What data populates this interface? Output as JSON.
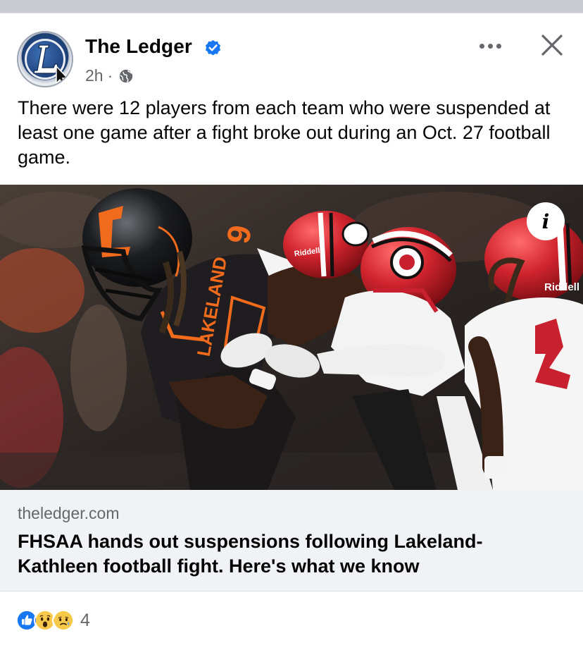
{
  "post": {
    "page_name": "The Ledger",
    "time": "2h",
    "separator": "·",
    "text": "There were 12 players from each team who were suspended at least one game after a fight broke out during an Oct. 27 football game."
  },
  "link": {
    "domain": "theledger.com",
    "title": "FHSAA hands out suspensions following Lakeland-Kathleen football fight. Here's what we know"
  },
  "photo": {
    "info_glyph": "i",
    "jersey_number": "6",
    "jersey_text": "LAKELAND",
    "helmet_brand": "Riddell"
  },
  "reactions": {
    "count": "4",
    "types": [
      "like",
      "wow",
      "sad"
    ]
  },
  "colors": {
    "verified": "#1877f2",
    "like": "#1877f2",
    "secondary_text": "#65676b",
    "link_bg": "#f0f2f5",
    "lakeland_orange": "#f26b1d",
    "kathleen_red": "#c8202e"
  },
  "icons": {
    "avatar": "ledger-logo",
    "verified": "verified-badge-icon",
    "audience": "globe-icon",
    "more": "more-options-icon",
    "close": "close-icon",
    "info": "info-icon"
  }
}
